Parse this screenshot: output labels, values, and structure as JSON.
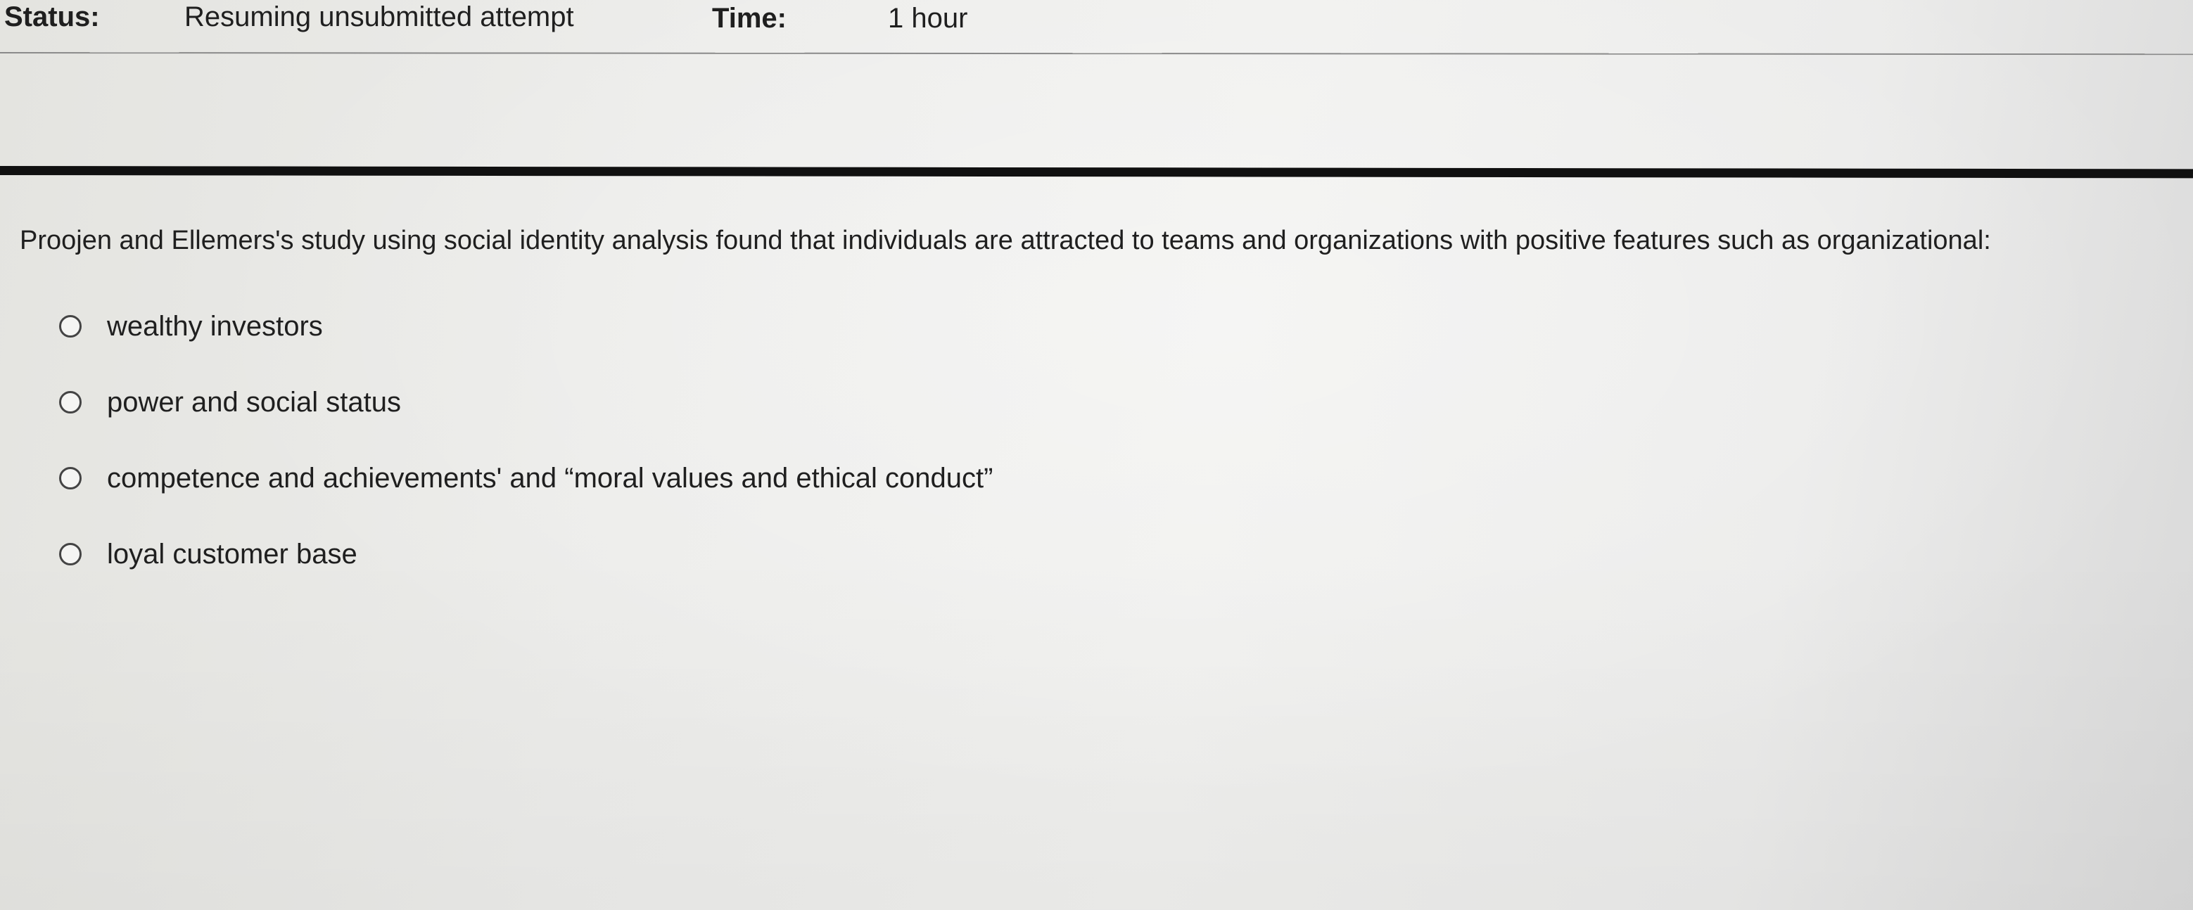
{
  "status_bar": {
    "status_label": "Status:",
    "status_value": "Resuming unsubmitted attempt",
    "time_label": "Time:",
    "time_value": "1 hour"
  },
  "question": {
    "text": "Proojen and Ellemers's study using social identity analysis found that individuals are attracted to teams and organizations with positive features such as organizational:",
    "options": [
      {
        "label": "wealthy investors"
      },
      {
        "label": "power and social status"
      },
      {
        "label": "competence and achievements' and “moral values and ethical conduct”"
      },
      {
        "label": "loyal customer base"
      }
    ]
  }
}
